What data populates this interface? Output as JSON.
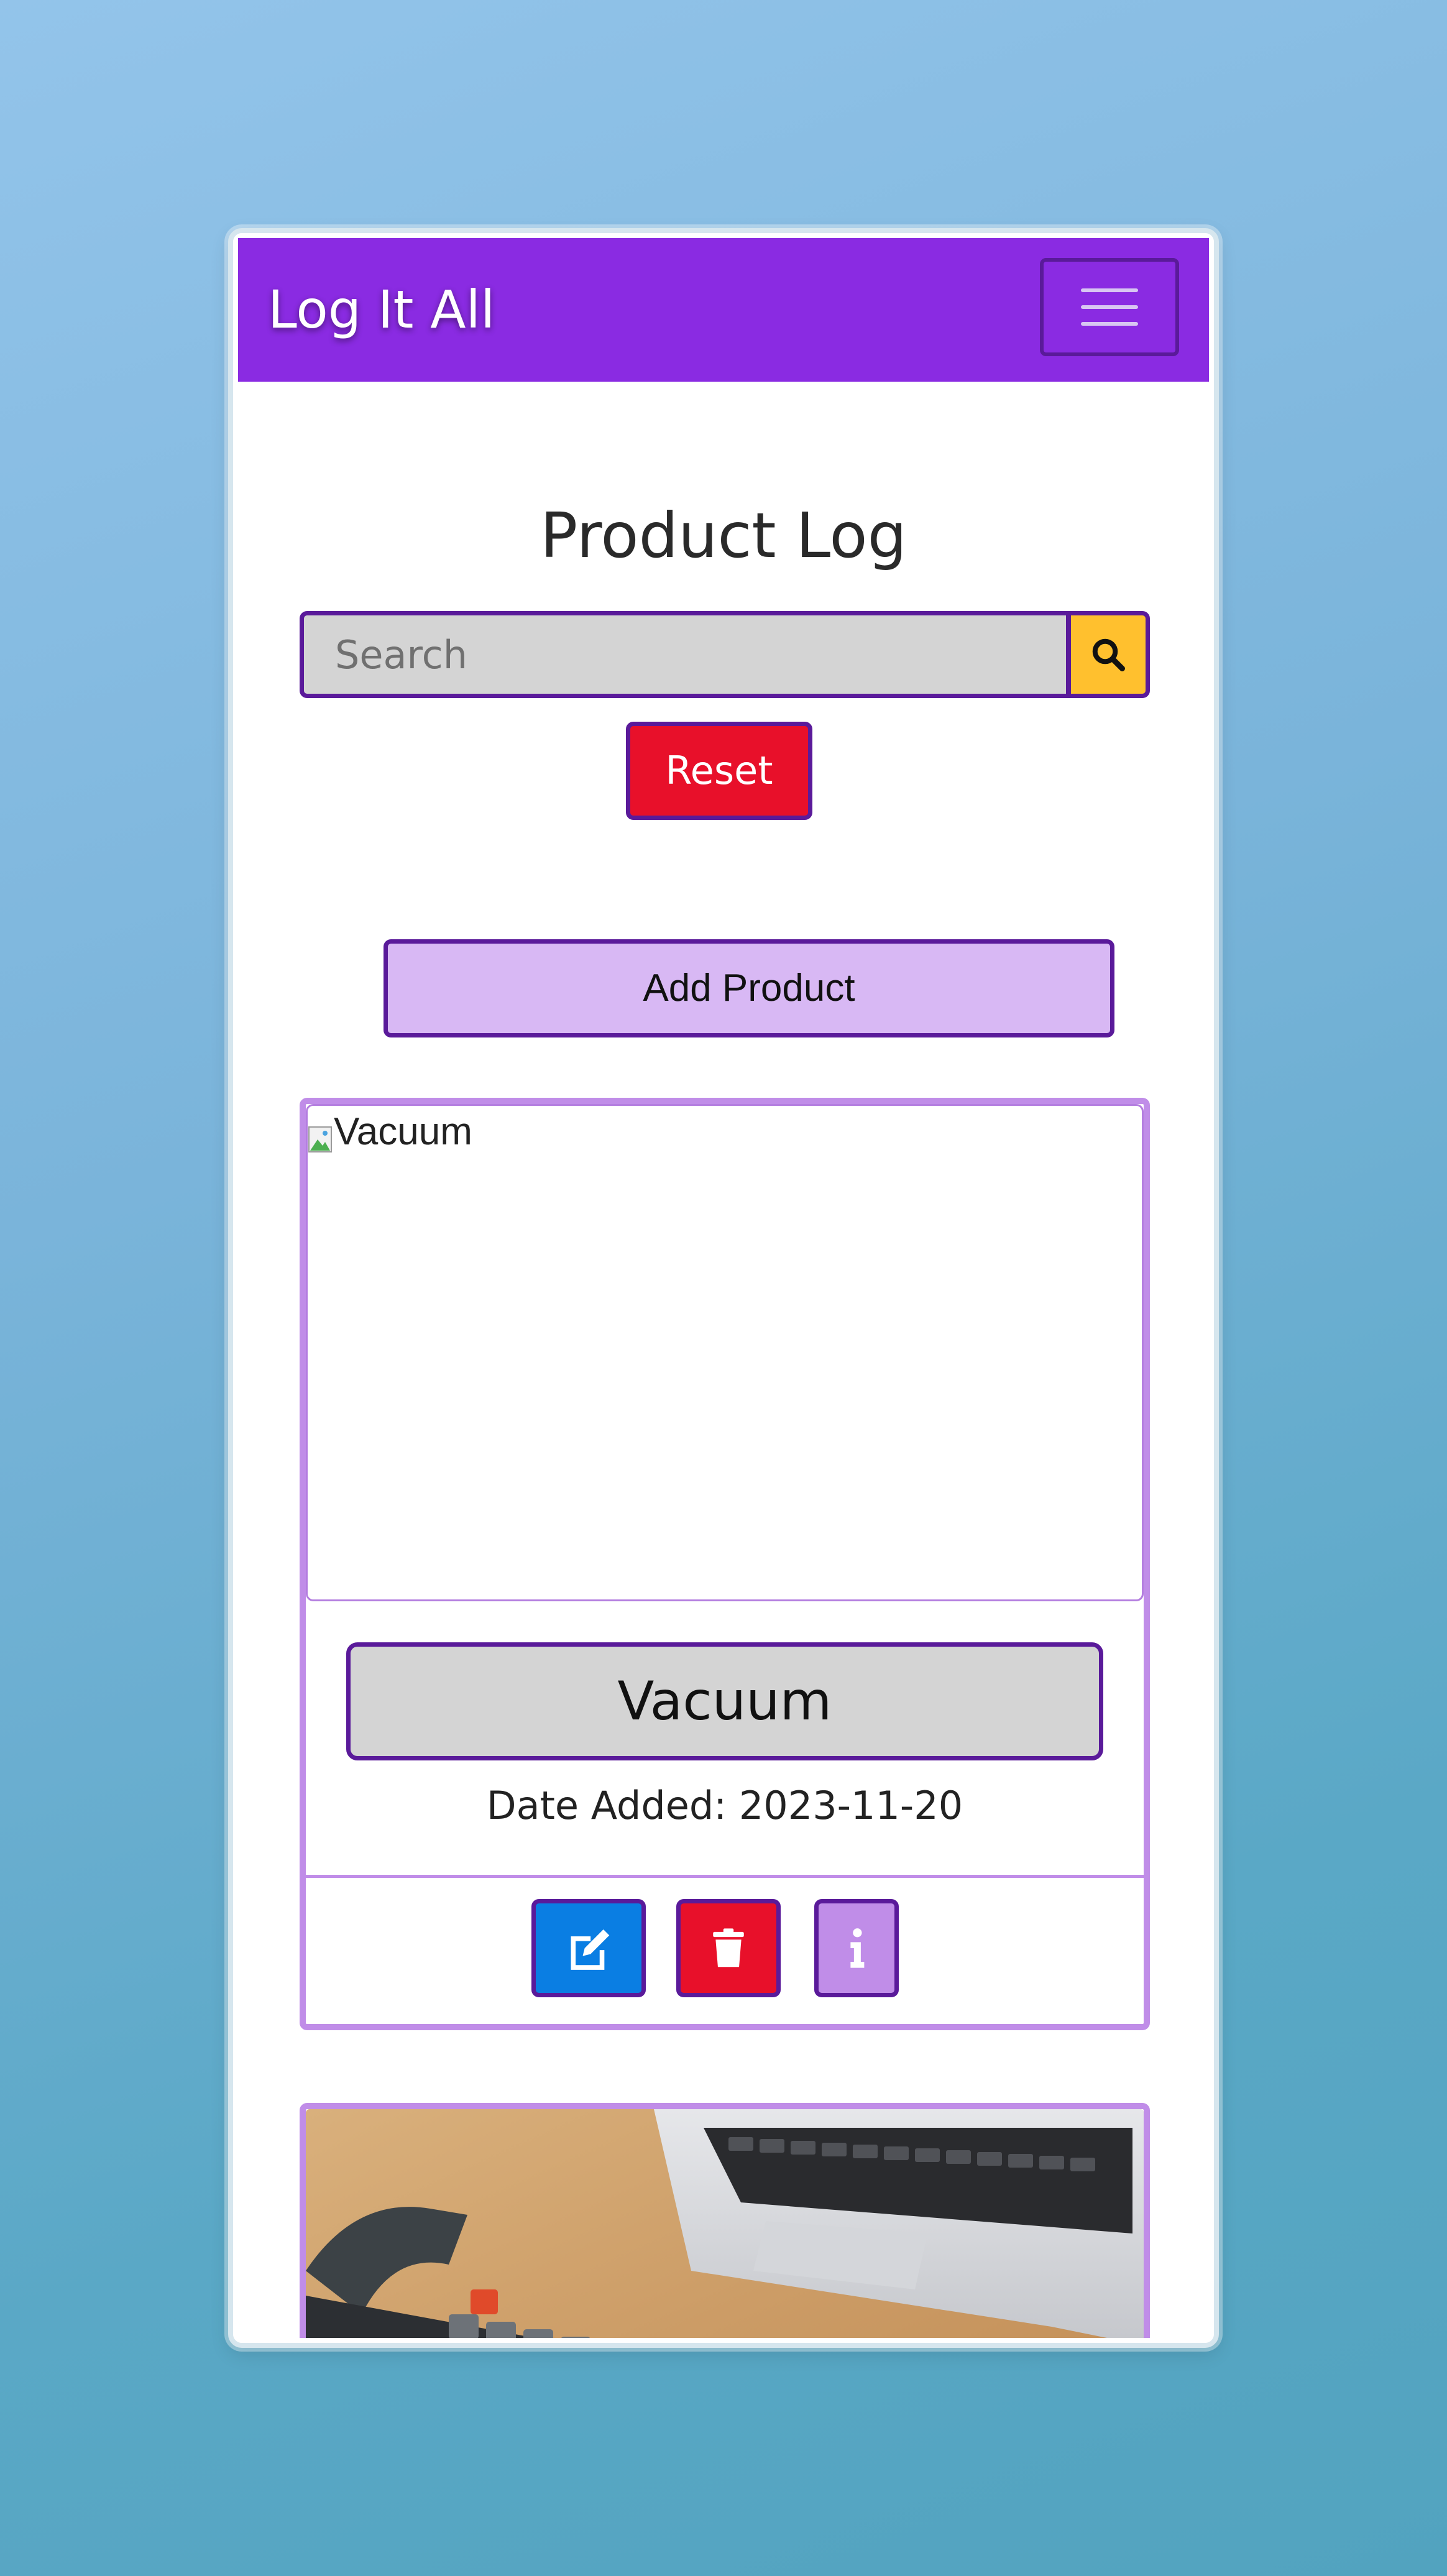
{
  "navbar": {
    "brand": "Log It All",
    "menu_icon": "hamburger-icon"
  },
  "page": {
    "title": "Product Log"
  },
  "search": {
    "placeholder": "Search",
    "button_icon": "search-icon",
    "reset_label": "Reset"
  },
  "actions": {
    "add_label": "Add Product"
  },
  "products": [
    {
      "image_alt": "Vacuum",
      "name": "Vacuum",
      "date_added": "Date Added: 2023-11-20",
      "buttons": [
        "edit-icon",
        "trash-icon",
        "info-icon"
      ]
    },
    {
      "image_description": "keyboard-and-laptop-photo"
    }
  ],
  "colors": {
    "navbar": "#8a2be2",
    "border": "#5a1a9a",
    "card_border": "#c08de8",
    "search_button": "#ffc02e",
    "reset_button": "#e8102a",
    "add_button": "#d8b8f4",
    "edit_button": "#0a7ee3",
    "delete_button": "#e8102a",
    "info_button": "#c08de8"
  }
}
